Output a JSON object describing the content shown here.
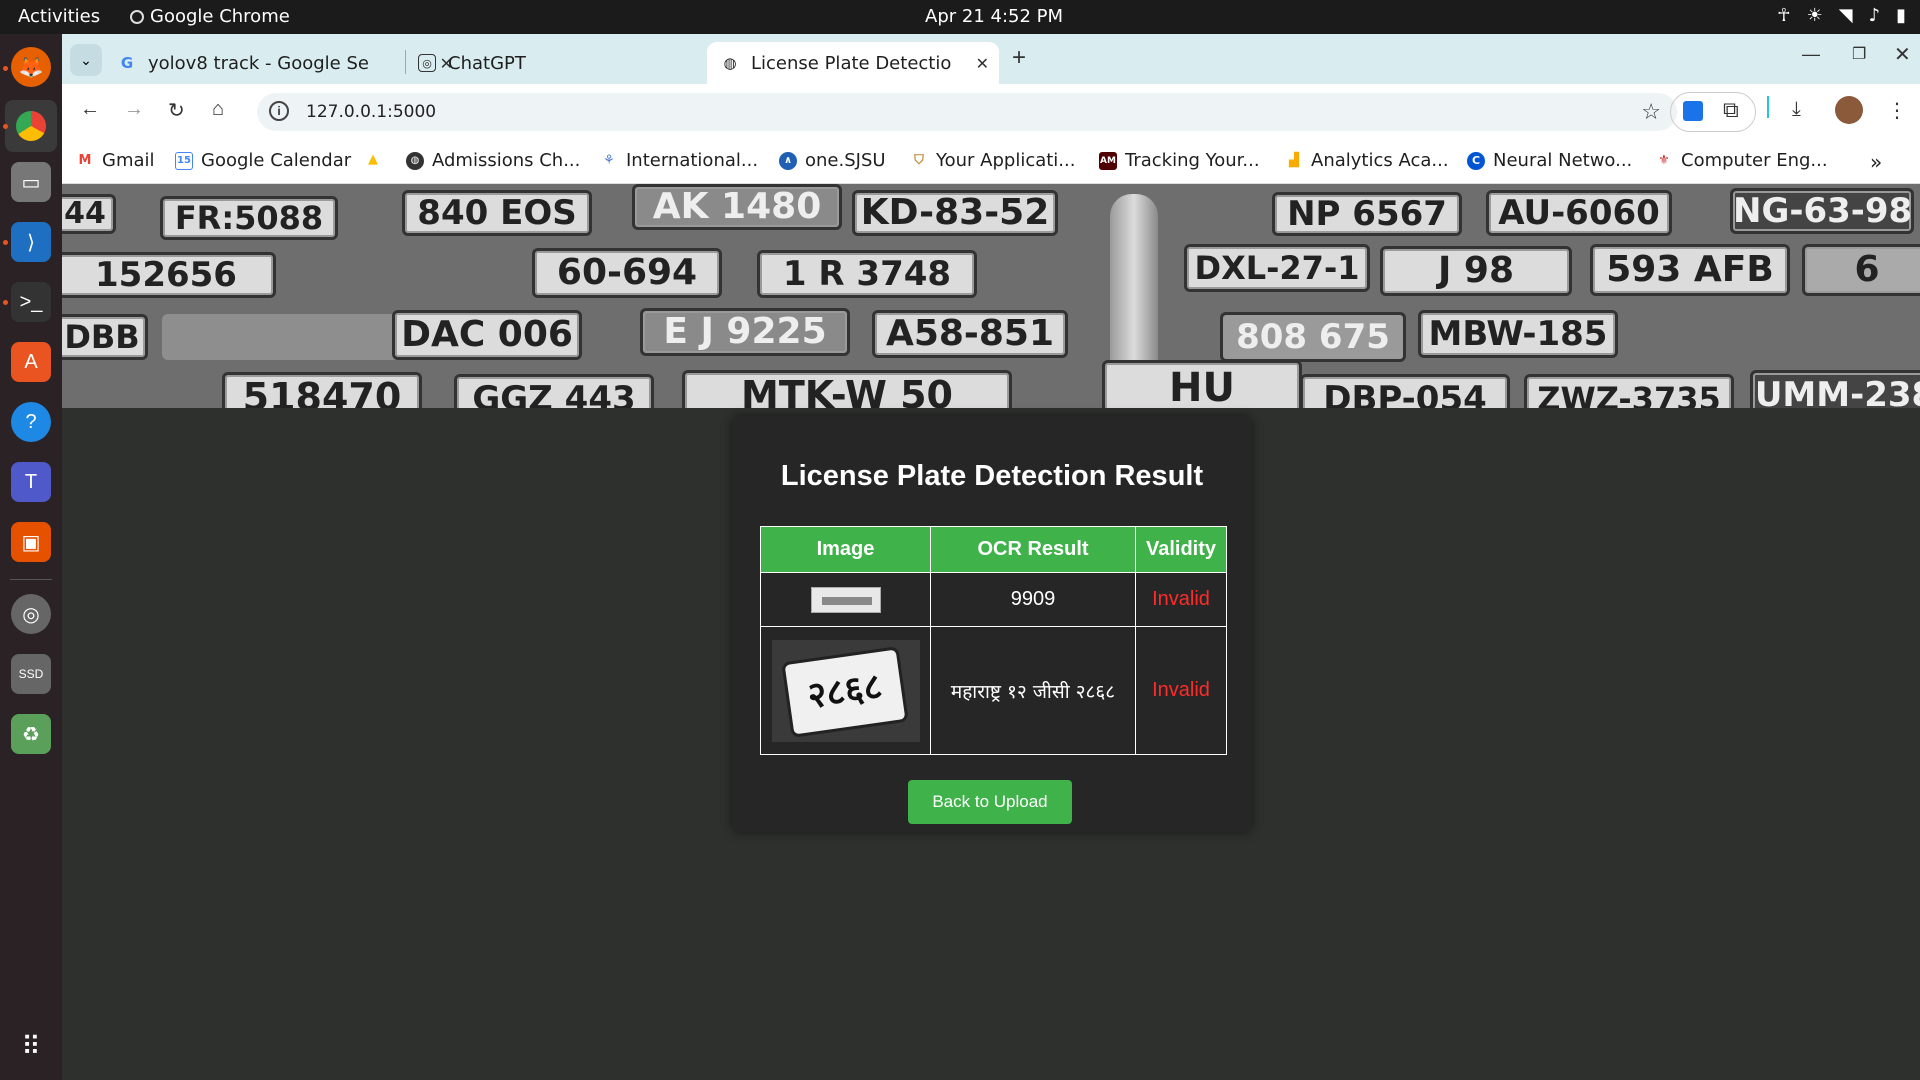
{
  "topbar": {
    "activities": "Activities",
    "app_name": "Google Chrome",
    "clock": "Apr 21  4:52 PM"
  },
  "tabs": [
    {
      "title": "yolov8 track - Google Se",
      "icon": "google-icon"
    },
    {
      "title": "ChatGPT",
      "icon": "chatgpt-icon"
    },
    {
      "title": "License Plate Detection",
      "icon": "globe-icon"
    }
  ],
  "address_bar": {
    "url": "127.0.0.1:5000"
  },
  "bookmarks": [
    {
      "label": "Gmail",
      "icon": "gmail-icon",
      "color": "#ea4335"
    },
    {
      "label": "Google Calendar",
      "icon": "calendar-icon",
      "color": "#4285f4"
    },
    {
      "label": "",
      "icon": "drive-icon",
      "color": "#fbbc04"
    },
    {
      "label": "Admissions Ch...",
      "icon": "globe-icon",
      "color": "#333333"
    },
    {
      "label": "International...",
      "icon": "intl-icon",
      "color": "#4a7bd6"
    },
    {
      "label": "one.SJSU",
      "icon": "sjsu-icon",
      "color": "#1f5fb4"
    },
    {
      "label": "Your Applicati...",
      "icon": "shield-icon",
      "color": "#c08a3a"
    },
    {
      "label": "Tracking Your...",
      "icon": "tamu-icon",
      "color": "#500000"
    },
    {
      "label": "Analytics Aca...",
      "icon": "analytics-icon",
      "color": "#f9ab00"
    },
    {
      "label": "Neural Netwo...",
      "icon": "coursera-icon",
      "color": "#0056d2"
    },
    {
      "label": "Computer Eng...",
      "icon": "uni-icon",
      "color": "#c62828"
    }
  ],
  "banner_plates": [
    "44",
    "FR:5088",
    "840 EOS",
    "AK 1480",
    "KD-83-52",
    "NP 6567",
    "AU-6060",
    "NG-63-98",
    "152656",
    "60-694",
    "1 R 3748",
    "DXL-27-1",
    "J 98",
    "593 AFB",
    "6",
    "DBB",
    "DAC 006",
    "E J 9225",
    "A58-851",
    "808 675",
    "MBW-185",
    "518470",
    "GGZ 443",
    "MTK-W 50",
    "HU",
    "DBP-054",
    "ZWZ-3735",
    "UMM-238"
  ],
  "result": {
    "heading": "License Plate Detection Result",
    "columns": [
      "Image",
      "OCR Result",
      "Validity"
    ],
    "rows": [
      {
        "ocr": "9909",
        "validity": "Invalid"
      },
      {
        "ocr": "महाराष्ट्र १२ जीसी २८६८",
        "validity": "Invalid"
      }
    ],
    "back_button": "Back to Upload"
  },
  "colors": {
    "accent_green": "#3fb24a",
    "invalid_red": "#ff2a2a",
    "page_bg": "#2e302e",
    "card_bg": "#262626"
  }
}
